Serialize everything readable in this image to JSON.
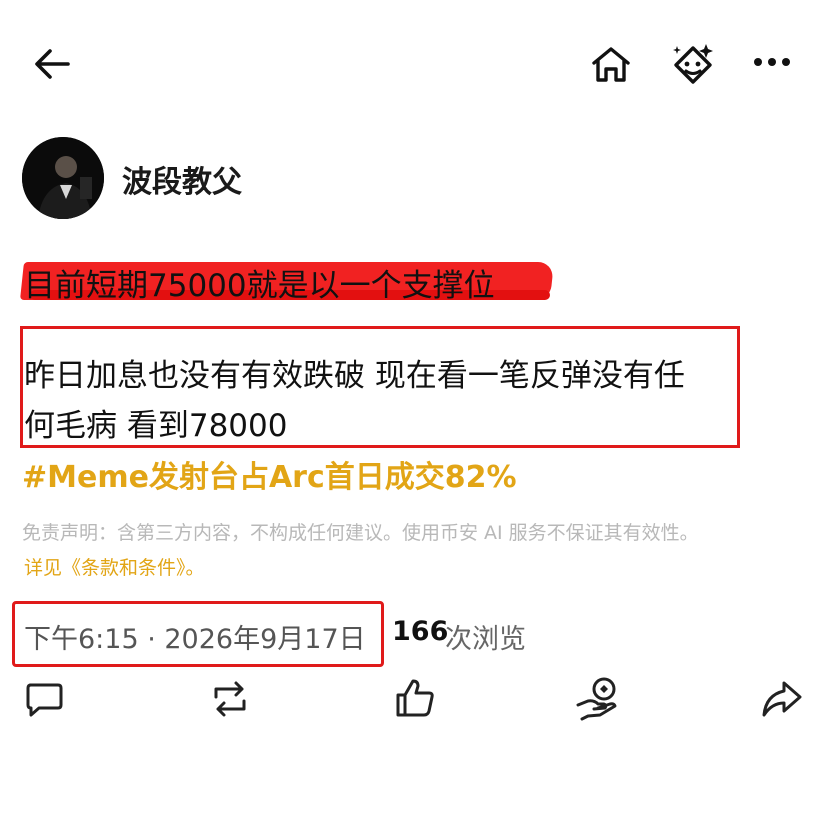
{
  "header": {
    "back_icon": "back-arrow-icon",
    "home_icon": "home-icon",
    "ai_icon": "ai-sparkle-face-icon",
    "more_icon": "more-dots-icon"
  },
  "author": {
    "name": "波段教父",
    "avatar": "avatar"
  },
  "post": {
    "headline": "目前短期75000就是以一个支撑位",
    "line1": "昨日加息也没有有效跌破 现在看一笔反弹没有任",
    "line2": "何毛病 看到78000",
    "hashtag": "#Meme发射台占Arc首日成交82%"
  },
  "disclaimer": {
    "text": "免责声明：含第三方内容，不构成任何建议。使用币安 AI 服务不保证其有效性。",
    "link": "详见《条款和条件》。"
  },
  "meta": {
    "datetime": "下午6:15 · 2026年9月17日",
    "views_count": "166",
    "views_label": "次浏览"
  },
  "actions": {
    "comment_icon": "comment-icon",
    "repost_icon": "repost-icon",
    "like_icon": "like-icon",
    "tip_icon": "tip-icon",
    "share_icon": "share-icon"
  },
  "colors": {
    "highlight_red": "#f01616",
    "box_red": "#e01a1a",
    "accent_gold": "#e2a516"
  }
}
